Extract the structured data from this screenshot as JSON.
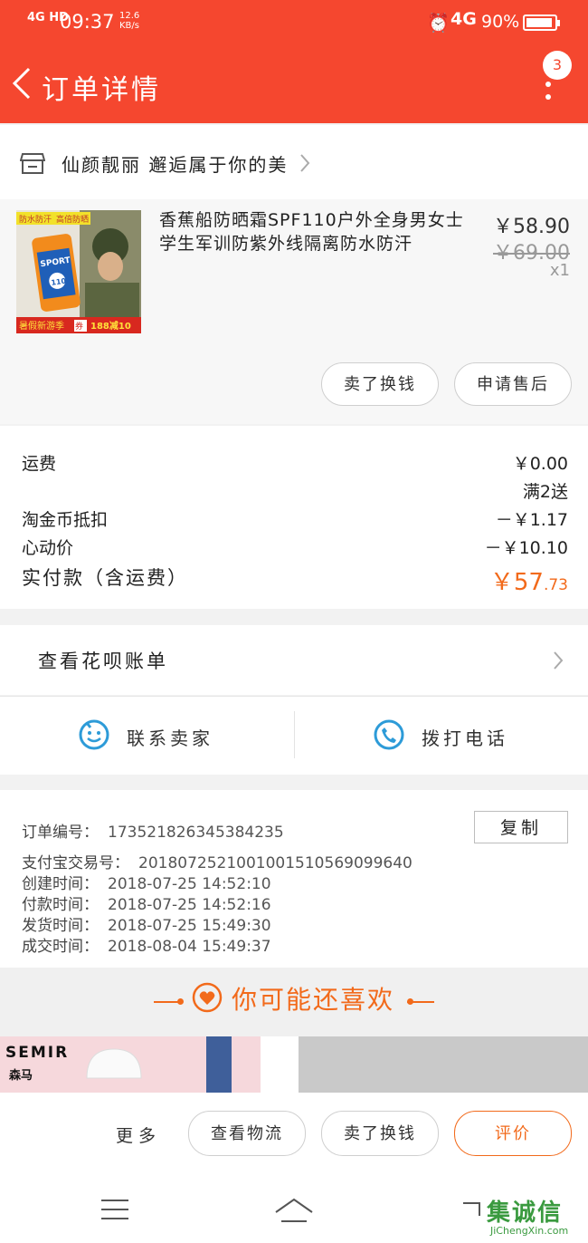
{
  "status_bar": {
    "signal": "4G HD",
    "time": "09:37",
    "speed": "12.6",
    "speed_unit": "KB/s",
    "network": "4G",
    "battery": "90%"
  },
  "nav": {
    "title": "订单详情",
    "badge": "3"
  },
  "shop": {
    "name": "仙颜靓丽 邂逅属于你的美"
  },
  "goods": {
    "title": "香蕉船防晒霜SPF110户外全身男女士学生军训防紫外线隔离防水防汗",
    "price": "￥58.90",
    "original_price": "￥69.00",
    "quantity": "x1",
    "buttons": [
      "卖了换钱",
      "申请售后"
    ],
    "image": {
      "tag_left": "防水防汗",
      "tag_right": "高倍防晒",
      "product_label": "SPORT",
      "spf": "110",
      "promo": "暑假新游季",
      "coupon": "券",
      "coupon_text": "188减10"
    }
  },
  "fees": {
    "shipping_label": "运费",
    "shipping_value": "￥0.00",
    "shipping_note": "满2送",
    "coin_label": "淘金币抵扣",
    "coin_value": "－￥1.17",
    "heart_label": "心动价",
    "heart_value": "－￥10.10",
    "total_label": "实付款（含运费）",
    "total_symbol": "￥",
    "total_int": "57",
    "total_dec": ".73"
  },
  "huabei": {
    "label": "查看花呗账单"
  },
  "contact": {
    "seller": "联系卖家",
    "phone": "拨打电话"
  },
  "order_info": {
    "order_no_label": "订单编号：",
    "order_no": "1735218263453842​35",
    "copy_label": "复制",
    "alipay_label": "支付宝交易号：",
    "alipay_no": "2018072521001001510569099640",
    "created_label": "创建时间：",
    "created": "2018-07-25 14:52:10",
    "paid_label": "付款时间：",
    "paid": "2018-07-25 14:52:16",
    "shipped_label": "发货时间：",
    "shipped": "2018-07-25 15:49:30",
    "done_label": "成交时间：",
    "done": "2018-08-04 15:49:37"
  },
  "recommend": {
    "label": "你可能还喜欢"
  },
  "products": {
    "brand": "SEMIR",
    "brand_cn": "森马"
  },
  "actions": {
    "more": "更多",
    "logistics": "查看物流",
    "resell": "卖了换钱",
    "evaluate": "评价"
  },
  "watermark": {
    "text": "集诚信",
    "url": "JiChengXin.com"
  },
  "colors": {
    "brand": "#f5472f",
    "accent": "#f26a1b"
  }
}
